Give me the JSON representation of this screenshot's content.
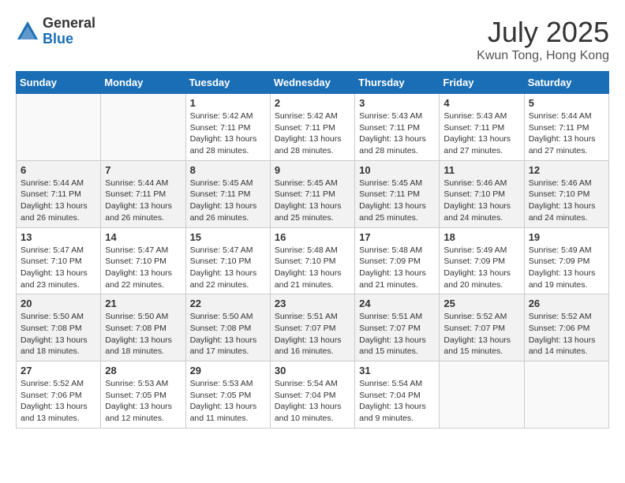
{
  "logo": {
    "general": "General",
    "blue": "Blue"
  },
  "title": "July 2025",
  "location": "Kwun Tong, Hong Kong",
  "weekdays": [
    "Sunday",
    "Monday",
    "Tuesday",
    "Wednesday",
    "Thursday",
    "Friday",
    "Saturday"
  ],
  "weeks": [
    [
      {
        "day": "",
        "info": ""
      },
      {
        "day": "",
        "info": ""
      },
      {
        "day": "1",
        "info": "Sunrise: 5:42 AM\nSunset: 7:11 PM\nDaylight: 13 hours and 28 minutes."
      },
      {
        "day": "2",
        "info": "Sunrise: 5:42 AM\nSunset: 7:11 PM\nDaylight: 13 hours and 28 minutes."
      },
      {
        "day": "3",
        "info": "Sunrise: 5:43 AM\nSunset: 7:11 PM\nDaylight: 13 hours and 28 minutes."
      },
      {
        "day": "4",
        "info": "Sunrise: 5:43 AM\nSunset: 7:11 PM\nDaylight: 13 hours and 27 minutes."
      },
      {
        "day": "5",
        "info": "Sunrise: 5:44 AM\nSunset: 7:11 PM\nDaylight: 13 hours and 27 minutes."
      }
    ],
    [
      {
        "day": "6",
        "info": "Sunrise: 5:44 AM\nSunset: 7:11 PM\nDaylight: 13 hours and 26 minutes."
      },
      {
        "day": "7",
        "info": "Sunrise: 5:44 AM\nSunset: 7:11 PM\nDaylight: 13 hours and 26 minutes."
      },
      {
        "day": "8",
        "info": "Sunrise: 5:45 AM\nSunset: 7:11 PM\nDaylight: 13 hours and 26 minutes."
      },
      {
        "day": "9",
        "info": "Sunrise: 5:45 AM\nSunset: 7:11 PM\nDaylight: 13 hours and 25 minutes."
      },
      {
        "day": "10",
        "info": "Sunrise: 5:45 AM\nSunset: 7:11 PM\nDaylight: 13 hours and 25 minutes."
      },
      {
        "day": "11",
        "info": "Sunrise: 5:46 AM\nSunset: 7:10 PM\nDaylight: 13 hours and 24 minutes."
      },
      {
        "day": "12",
        "info": "Sunrise: 5:46 AM\nSunset: 7:10 PM\nDaylight: 13 hours and 24 minutes."
      }
    ],
    [
      {
        "day": "13",
        "info": "Sunrise: 5:47 AM\nSunset: 7:10 PM\nDaylight: 13 hours and 23 minutes."
      },
      {
        "day": "14",
        "info": "Sunrise: 5:47 AM\nSunset: 7:10 PM\nDaylight: 13 hours and 22 minutes."
      },
      {
        "day": "15",
        "info": "Sunrise: 5:47 AM\nSunset: 7:10 PM\nDaylight: 13 hours and 22 minutes."
      },
      {
        "day": "16",
        "info": "Sunrise: 5:48 AM\nSunset: 7:10 PM\nDaylight: 13 hours and 21 minutes."
      },
      {
        "day": "17",
        "info": "Sunrise: 5:48 AM\nSunset: 7:09 PM\nDaylight: 13 hours and 21 minutes."
      },
      {
        "day": "18",
        "info": "Sunrise: 5:49 AM\nSunset: 7:09 PM\nDaylight: 13 hours and 20 minutes."
      },
      {
        "day": "19",
        "info": "Sunrise: 5:49 AM\nSunset: 7:09 PM\nDaylight: 13 hours and 19 minutes."
      }
    ],
    [
      {
        "day": "20",
        "info": "Sunrise: 5:50 AM\nSunset: 7:08 PM\nDaylight: 13 hours and 18 minutes."
      },
      {
        "day": "21",
        "info": "Sunrise: 5:50 AM\nSunset: 7:08 PM\nDaylight: 13 hours and 18 minutes."
      },
      {
        "day": "22",
        "info": "Sunrise: 5:50 AM\nSunset: 7:08 PM\nDaylight: 13 hours and 17 minutes."
      },
      {
        "day": "23",
        "info": "Sunrise: 5:51 AM\nSunset: 7:07 PM\nDaylight: 13 hours and 16 minutes."
      },
      {
        "day": "24",
        "info": "Sunrise: 5:51 AM\nSunset: 7:07 PM\nDaylight: 13 hours and 15 minutes."
      },
      {
        "day": "25",
        "info": "Sunrise: 5:52 AM\nSunset: 7:07 PM\nDaylight: 13 hours and 15 minutes."
      },
      {
        "day": "26",
        "info": "Sunrise: 5:52 AM\nSunset: 7:06 PM\nDaylight: 13 hours and 14 minutes."
      }
    ],
    [
      {
        "day": "27",
        "info": "Sunrise: 5:52 AM\nSunset: 7:06 PM\nDaylight: 13 hours and 13 minutes."
      },
      {
        "day": "28",
        "info": "Sunrise: 5:53 AM\nSunset: 7:05 PM\nDaylight: 13 hours and 12 minutes."
      },
      {
        "day": "29",
        "info": "Sunrise: 5:53 AM\nSunset: 7:05 PM\nDaylight: 13 hours and 11 minutes."
      },
      {
        "day": "30",
        "info": "Sunrise: 5:54 AM\nSunset: 7:04 PM\nDaylight: 13 hours and 10 minutes."
      },
      {
        "day": "31",
        "info": "Sunrise: 5:54 AM\nSunset: 7:04 PM\nDaylight: 13 hours and 9 minutes."
      },
      {
        "day": "",
        "info": ""
      },
      {
        "day": "",
        "info": ""
      }
    ]
  ]
}
